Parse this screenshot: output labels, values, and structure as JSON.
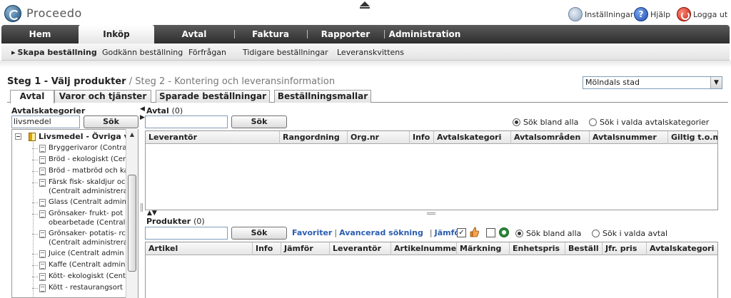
{
  "app": {
    "name": "Proceedo"
  },
  "top_links": {
    "settings": "Inställningar",
    "help": "Hjälp",
    "logout": "Logga ut"
  },
  "main_nav": [
    {
      "label": "Hem",
      "active": false
    },
    {
      "label": "Inköp",
      "active": true
    },
    {
      "label": "Avtal",
      "active": false
    },
    {
      "label": "Faktura",
      "active": false
    },
    {
      "label": "Rapporter",
      "active": false
    },
    {
      "label": "Administration",
      "active": false
    }
  ],
  "sub_nav": [
    {
      "label": "Skapa beställning",
      "active": true
    },
    {
      "label": "Godkänn beställning",
      "active": false
    },
    {
      "label": "Förfrågan",
      "active": false
    },
    {
      "label": "Tidigare beställningar",
      "active": false
    },
    {
      "label": "Leveranskvittens",
      "active": false
    }
  ],
  "steps": {
    "step1": "Steg 1 - Välj produkter",
    "step2": " / Steg 2 - Kontering och leveransinformation"
  },
  "org_select": {
    "value": "Mölndals stad"
  },
  "content_tabs": [
    {
      "label": "Avtal",
      "active": true
    },
    {
      "label": "Varor och tjänster",
      "active": false
    },
    {
      "label": "Sparade beställningar",
      "active": false
    },
    {
      "label": "Beställningsmallar",
      "active": false
    }
  ],
  "categories": {
    "label": "Avtalskategorier",
    "search_value": "livsmedel",
    "search_button": "Sök",
    "tree_root": "Livsmedel - Övriga va",
    "tree_items": [
      "Bryggerivaror (Contrar",
      "Bröd - ekologiskt (Cent",
      "Bröd - matbröd och ka",
      "Färsk fisk- skaldjur oc|(Centralt administrera",
      "Glass (Centralt admin",
      "Grönsaker- frukt- pot|obearbetade (Central",
      "Grönsaker- potatis- rc|(Centralt administrera",
      "Juice (Centralt admin",
      "Kaffe (Centralt admin",
      "Kött- ekologiskt (Cent",
      "Kött - restaurangsort"
    ]
  },
  "avtal": {
    "label": "Avtal",
    "count": "(0)",
    "search_value": "",
    "search_button": "Sök",
    "radio_all": "Sök bland alla",
    "radio_selected": "Sök i valda avtalskategorier",
    "columns": [
      "Leverantör",
      "Rangordning",
      "Org.nr",
      "Info",
      "Avtalskategori",
      "Avtalsområden",
      "Avtalsnummer",
      "Giltig t.o.m."
    ]
  },
  "produkter": {
    "label": "Produkter",
    "count": "(0)",
    "search_value": "",
    "search_button": "Sök",
    "links": {
      "favoriter": "Favoriter",
      "avancerad": "Avancerad sökning",
      "jamfor": "Jämför"
    },
    "radio_all": "Sök bland alla",
    "radio_selected": "Sök i valda avtal",
    "columns": [
      "Artikel",
      "Info",
      "Jämför",
      "Leverantör",
      "Artikelnummer",
      "Märkning",
      "Enhetspris",
      "Beställ",
      "Jfr. pris",
      "Avtalskategori"
    ]
  },
  "colors": {
    "nav_dark": "#3a3a3a",
    "link_blue": "#2a5db0",
    "accent_folder": "#d9a400"
  },
  "icons": [
    "logo-icon",
    "collapse-arrow-icon",
    "settings-icon",
    "help-icon",
    "logout-icon",
    "tree-minus-icon",
    "folder-books-icon",
    "document-icon",
    "thumb-up-icon",
    "clock-icon",
    "dropdown-arrow-icon"
  ]
}
